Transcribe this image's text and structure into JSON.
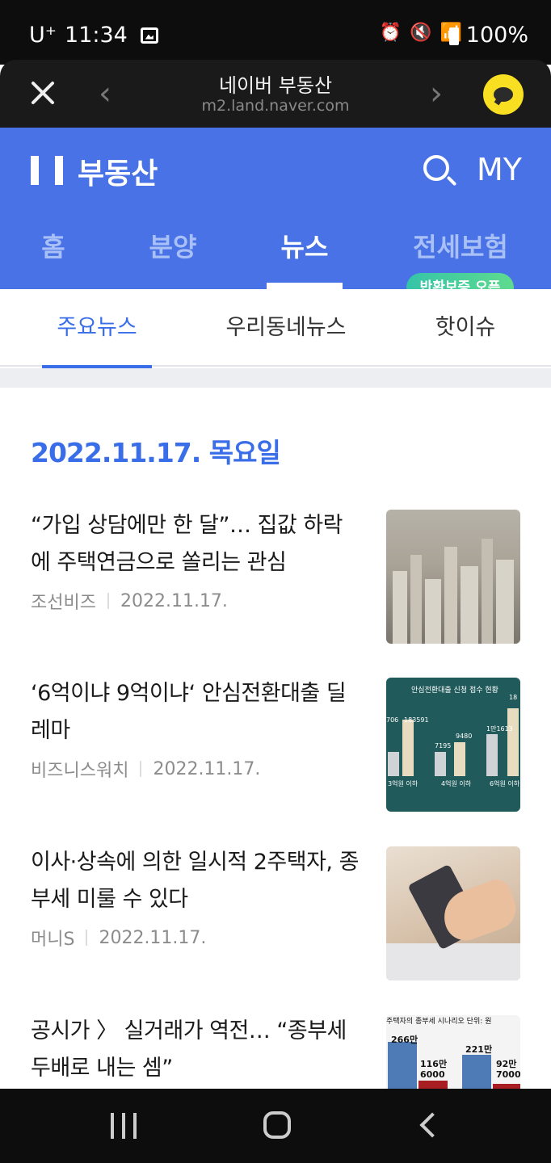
{
  "status_bar": {
    "carrier": "U⁺",
    "time": "11:34",
    "battery": "100%"
  },
  "browser": {
    "title": "네이버 부동산",
    "url": "m2.land.naver.com"
  },
  "header": {
    "logo_text": "부동산",
    "my_label": "MY",
    "tabs": [
      {
        "label": "홈",
        "active": false
      },
      {
        "label": "분양",
        "active": false
      },
      {
        "label": "뉴스",
        "active": true
      },
      {
        "label": "전세보험",
        "active": false
      }
    ],
    "badge": "반환보증 오픈"
  },
  "sub_tabs": [
    {
      "label": "주요뉴스",
      "active": true
    },
    {
      "label": "우리동네뉴스",
      "active": false
    },
    {
      "label": "핫이슈",
      "active": false
    }
  ],
  "date_heading": "2022.11.17. 목요일",
  "news": [
    {
      "title": "“가입 상담에만 한 달”… 집값 하락에 주택연금으로 쏠리는 관심",
      "source": "조선비즈",
      "date": "2022.11.17.",
      "thumb_icon": "city-photo"
    },
    {
      "title": "‘6억이냐 9억이냐‘ 안심전환대출 딜레마",
      "source": "비즈니스워치",
      "date": "2022.11.17.",
      "thumb_icon": "chart-image",
      "thumb_text": {
        "heading": "안심전환대출 신청 접수 현황",
        "v1": "706",
        "v2": "183591",
        "v3": "7195",
        "v4": "9480",
        "v5": "1만1613",
        "v6": "18",
        "l1": "3억원 이하",
        "l2": "4억원 이하",
        "l3": "6억원 이하"
      }
    },
    {
      "title": "이사·상속에 의한 일시적 2주택자, 종부세 미룰 수 있다",
      "source": "머니S",
      "date": "2022.11.17.",
      "thumb_icon": "calculator-photo"
    },
    {
      "title": "공시가 〉 실거래가 역전… “종부세 두배로 내는 셈”",
      "source": "",
      "date": "",
      "thumb_icon": "tax-chart-image",
      "thumb_text": {
        "heading": "주택자의 종부세 시나리오 단위: 원",
        "v1": "266만",
        "v2": "116만 6000",
        "v3": "221만",
        "v4": "92만 7000"
      }
    }
  ],
  "colors": {
    "naver_blue": "#4872e6",
    "active_blue": "#3a6ee8",
    "badge_green": "#35c4a8"
  }
}
